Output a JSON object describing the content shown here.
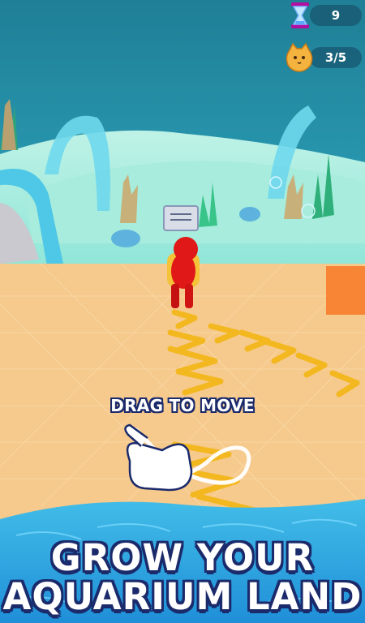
{
  "hud": {
    "hourglass_count": "9",
    "cat_progress": "3/5"
  },
  "hud_icons": {
    "hourglass": "hourglass-icon",
    "cat": "cat-face-icon"
  },
  "hint": {
    "text": "DRAG TO MOVE"
  },
  "banner": {
    "line1": "GROW YOUR",
    "line2": "AQUARIUM LAND"
  },
  "colors": {
    "water": "#2f9fc4",
    "sand": "#f6c98c",
    "arrow": "#f3b81f",
    "player": "#e01818",
    "title_outline": "#1b2a6b"
  }
}
